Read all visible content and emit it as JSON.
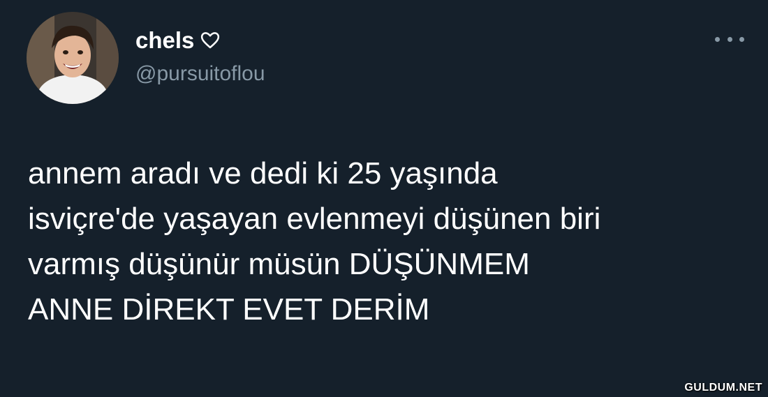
{
  "user": {
    "display_name": "chels",
    "username": "@pursuitoflou",
    "avatar_icon": "profile-photo"
  },
  "more_icon": "ellipsis-icon",
  "name_badge_icon": "heart-outline-icon",
  "tweet": {
    "lines": [
      "annem aradı ve dedi ki 25 yaşında",
      "isviçre'de yaşayan evlenmeyi düşünen biri",
      "varmış düşünür müsün DÜŞÜNMEM",
      "ANNE DİREKT EVET DERİM"
    ]
  },
  "watermark": "GULDUM.NET",
  "colors": {
    "background": "#15202b",
    "text": "#ffffff",
    "secondary_text": "#8899a6"
  }
}
